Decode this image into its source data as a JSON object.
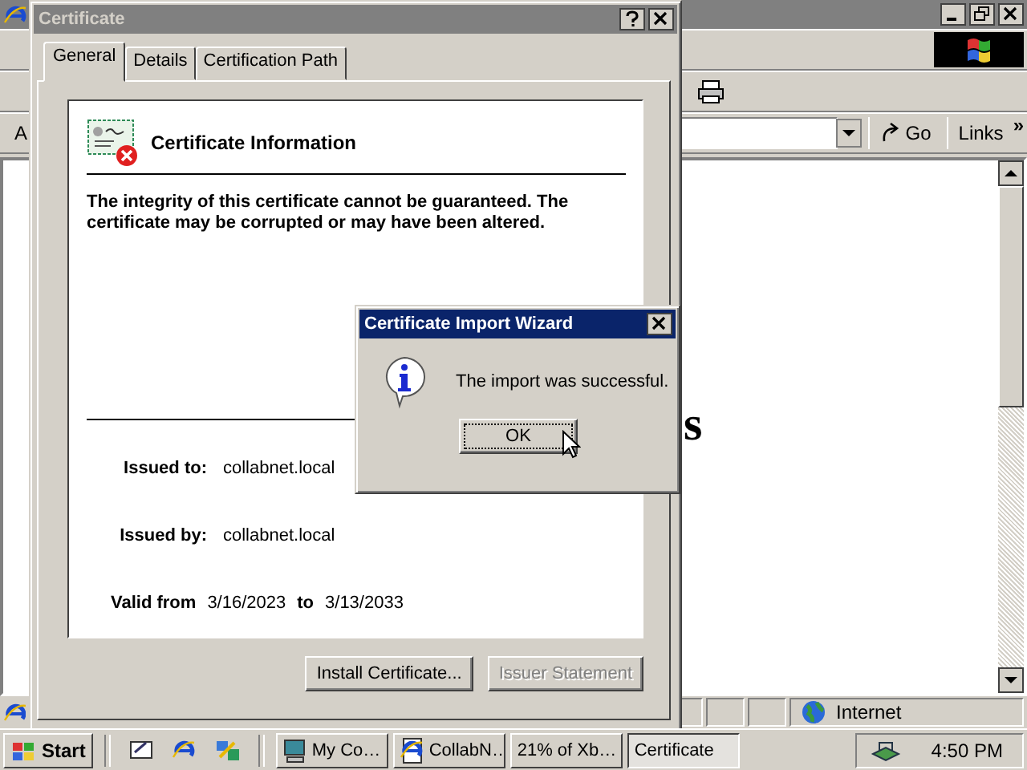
{
  "browser": {
    "address_label": "A",
    "go_label": "Go",
    "links_label": "Links",
    "links_chevron": "»",
    "page_fragment": "s",
    "status_zone": "Internet"
  },
  "certificate_dialog": {
    "title": "Certificate",
    "active": false,
    "tabs": [
      {
        "label": "General",
        "selected": true
      },
      {
        "label": "Details",
        "selected": false
      },
      {
        "label": "Certification Path",
        "selected": false
      }
    ],
    "header": "Certificate Information",
    "warning": "The integrity of this certificate cannot be guaranteed. The certificate may be corrupted or may have been altered.",
    "fields": [
      {
        "label": "Issued to:",
        "value": "collabnet.local"
      },
      {
        "label": "Issued by:",
        "value": "collabnet.local"
      }
    ],
    "validity": {
      "from_label": "Valid from",
      "from": "3/16/2023",
      "to_label": "to",
      "to": "3/13/2033"
    },
    "buttons": [
      {
        "label": "Install Certificate...",
        "disabled": false
      },
      {
        "label": "Issuer Statement",
        "disabled": true
      }
    ]
  },
  "import_wizard": {
    "title": "Certificate Import Wizard",
    "active": true,
    "message": "The import was successful.",
    "button": "OK"
  },
  "taskbar": {
    "start": "Start",
    "tasks": [
      {
        "label": "My Co…",
        "kind": "computer",
        "selected": false
      },
      {
        "label": "CollabN…",
        "kind": "browser",
        "selected": false
      },
      {
        "label": "21% of Xb…",
        "selected": false
      },
      {
        "label": "Certificate",
        "selected": true
      }
    ],
    "clock": "4:50 PM"
  }
}
